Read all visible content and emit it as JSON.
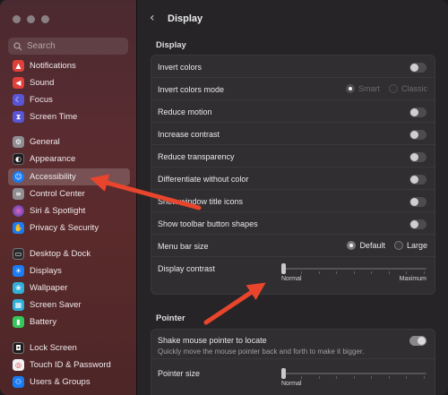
{
  "sidebar": {
    "search_placeholder": "Search",
    "items": [
      {
        "label": "Notifications",
        "icon": "bell-icon",
        "color": "#e0403a",
        "glyph": "🔔"
      },
      {
        "label": "Sound",
        "icon": "speaker-icon",
        "color": "#e0403a",
        "glyph": "🔊"
      },
      {
        "label": "Focus",
        "icon": "moon-icon",
        "color": "#5856d6",
        "glyph": "☾"
      },
      {
        "label": "Screen Time",
        "icon": "hourglass-icon",
        "color": "#5856d6",
        "glyph": "⌛"
      },
      {
        "label": "General",
        "icon": "gear-icon",
        "color": "#8e8e93",
        "glyph": "⚙"
      },
      {
        "label": "Appearance",
        "icon": "appearance-icon",
        "color": "#1c1c1e",
        "glyph": "◐"
      },
      {
        "label": "Accessibility",
        "icon": "accessibility-icon",
        "color": "#1a7cf5",
        "glyph": "♿"
      },
      {
        "label": "Control Center",
        "icon": "control-center-icon",
        "color": "#8e8e93",
        "glyph": "▤"
      },
      {
        "label": "Siri & Spotlight",
        "icon": "siri-icon",
        "color": "#2b2b6e",
        "glyph": "◉"
      },
      {
        "label": "Privacy & Security",
        "icon": "hand-icon",
        "color": "#1a7cf5",
        "glyph": "✋"
      },
      {
        "label": "Desktop & Dock",
        "icon": "dock-icon",
        "color": "#2a2a2c",
        "glyph": "▭"
      },
      {
        "label": "Displays",
        "icon": "display-icon",
        "color": "#1a7cf5",
        "glyph": "☀"
      },
      {
        "label": "Wallpaper",
        "icon": "wallpaper-icon",
        "color": "#30b0d8",
        "glyph": "❀"
      },
      {
        "label": "Screen Saver",
        "icon": "screen-saver-icon",
        "color": "#30b0d8",
        "glyph": "▦"
      },
      {
        "label": "Battery",
        "icon": "battery-icon",
        "color": "#34c759",
        "glyph": "▮"
      },
      {
        "label": "Lock Screen",
        "icon": "lock-icon",
        "color": "#1c1c1e",
        "glyph": "🔒"
      },
      {
        "label": "Touch ID & Password",
        "icon": "fingerprint-icon",
        "color": "#f2f2f4",
        "glyph": "☉"
      },
      {
        "label": "Users & Groups",
        "icon": "users-icon",
        "color": "#1a7cf5",
        "glyph": "👥"
      }
    ],
    "selected": "Accessibility"
  },
  "header": {
    "back_glyph": "‹",
    "title": "Display"
  },
  "display_section": {
    "heading": "Display",
    "rows": {
      "invert_colors": {
        "label": "Invert colors",
        "on": false
      },
      "invert_colors_mode": {
        "label": "Invert colors mode",
        "options": [
          "Smart",
          "Classic"
        ]
      },
      "reduce_motion": {
        "label": "Reduce motion",
        "on": false
      },
      "increase_contrast": {
        "label": "Increase contrast",
        "on": false
      },
      "reduce_transparency": {
        "label": "Reduce transparency",
        "on": false
      },
      "differentiate_without_color": {
        "label": "Differentiate without color",
        "on": false
      },
      "show_window_title_icons": {
        "label": "Show window title icons",
        "on": false
      },
      "show_toolbar_button_shapes": {
        "label": "Show toolbar button shapes",
        "on": false
      },
      "menu_bar_size": {
        "label": "Menu bar size",
        "options": [
          "Default",
          "Large"
        ],
        "selected": "Default"
      },
      "display_contrast": {
        "label": "Display contrast",
        "min_label": "Normal",
        "max_label": "Maximum",
        "value": 0
      }
    }
  },
  "pointer_section": {
    "heading": "Pointer",
    "shake": {
      "label": "Shake mouse pointer to locate",
      "description": "Quickly move the mouse pointer back and forth to make it bigger.",
      "on": true
    },
    "pointer_size": {
      "label": "Pointer size",
      "min_label": "Normal",
      "value": 0
    }
  },
  "colors": {
    "arrow": "#e8452c"
  }
}
